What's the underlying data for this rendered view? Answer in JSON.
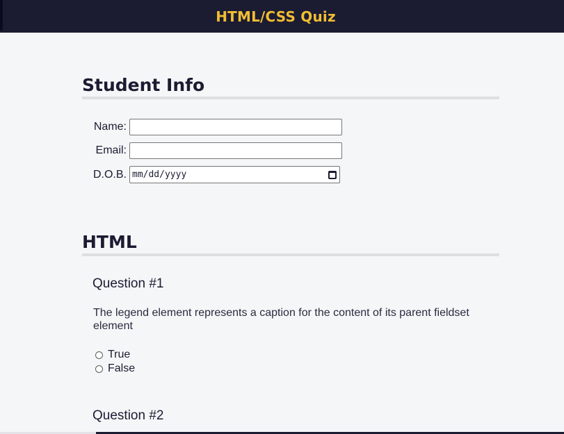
{
  "header": {
    "title": "HTML/CSS Quiz"
  },
  "student_info": {
    "title": "Student Info",
    "fields": [
      {
        "label": "Name:",
        "value": ""
      },
      {
        "label": "Email:",
        "value": ""
      },
      {
        "label": "D.O.B.",
        "placeholder": "mm/dd/yyyy"
      }
    ]
  },
  "html_section": {
    "title": "HTML",
    "questions": [
      {
        "title": "Question #1",
        "text": "The legend element represents a caption for the content of its parent fieldset element",
        "options": [
          "True",
          "False"
        ]
      },
      {
        "title": "Question #2"
      }
    ]
  },
  "icons": {
    "date_picker": "calendar-icon",
    "radio": "radio-circle"
  },
  "colors": {
    "header_bg": "#1b1b32",
    "header_title": "#f1be32",
    "page_bg": "#f5f6f7",
    "section_rule": "#dfdfe2"
  }
}
